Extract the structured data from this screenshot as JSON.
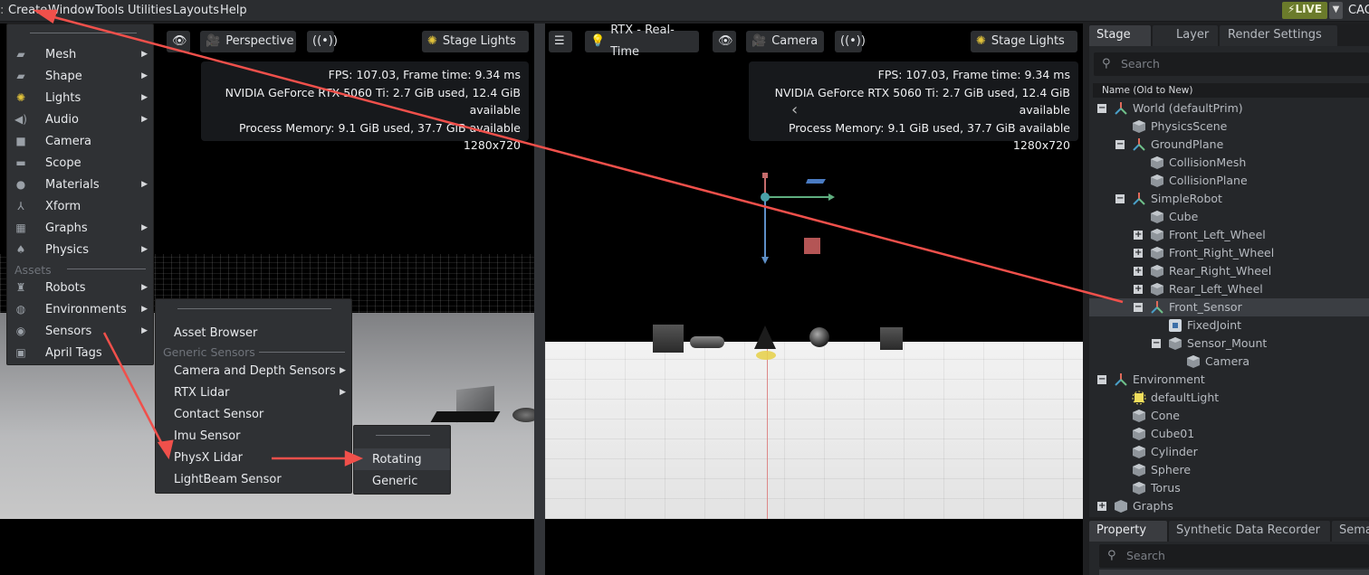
{
  "menubar": {
    "items": [
      "Create",
      "Window",
      "Tools",
      "Utilities",
      "Layouts",
      "Help"
    ],
    "live_label": "LIVE",
    "right_cut": "CAC"
  },
  "left_viewport": {
    "camera_label": "Perspective",
    "lights_label": "Stage Lights",
    "stats": [
      "FPS: 107.03, Frame time: 9.34 ms",
      "NVIDIA GeForce RTX 5060 Ti: 2.7 GiB used, 12.4 GiB available",
      "Process Memory: 9.1 GiB used, 37.7 GiB available",
      "1280x720"
    ]
  },
  "right_viewport": {
    "render_label": "RTX - Real-Time",
    "camera_label": "Camera",
    "lights_label": "Stage Lights",
    "stats": [
      "FPS: 107.03, Frame time: 9.34 ms",
      "NVIDIA GeForce RTX 5060 Ti: 2.7 GiB used, 12.4 GiB available",
      "Process Memory: 9.1 GiB used, 37.7 GiB available",
      "1280x720"
    ]
  },
  "create_menu": {
    "items": [
      {
        "label": "Mesh",
        "icon": "mesh-icon",
        "submenu": true
      },
      {
        "label": "Shape",
        "icon": "shape-icon",
        "submenu": true
      },
      {
        "label": "Lights",
        "icon": "light-icon",
        "submenu": true
      },
      {
        "label": "Audio",
        "icon": "audio-icon",
        "submenu": true
      },
      {
        "label": "Camera",
        "icon": "camera-icon",
        "submenu": false
      },
      {
        "label": "Scope",
        "icon": "folder-icon",
        "submenu": false
      },
      {
        "label": "Materials",
        "icon": "sphere-icon",
        "submenu": true
      },
      {
        "label": "Xform",
        "icon": "xform-icon",
        "submenu": false
      },
      {
        "label": "Graphs",
        "icon": "graph-icon",
        "submenu": true
      },
      {
        "label": "Physics",
        "icon": "physics-icon",
        "submenu": true
      }
    ],
    "assets_header": "Assets",
    "asset_items": [
      {
        "label": "Robots",
        "icon": "robot-icon",
        "submenu": true
      },
      {
        "label": "Environments",
        "icon": "globe-icon",
        "submenu": true
      },
      {
        "label": "Sensors",
        "icon": "sensor-icon",
        "submenu": true
      },
      {
        "label": "April Tags",
        "icon": "apriltag-icon",
        "submenu": false
      }
    ]
  },
  "sensors_menu": {
    "top_item": "Asset Browser",
    "header": "Generic Sensors",
    "items": [
      {
        "label": "Camera and Depth Sensors",
        "submenu": true
      },
      {
        "label": "RTX Lidar",
        "submenu": true
      },
      {
        "label": "Contact Sensor",
        "submenu": false
      },
      {
        "label": "Imu Sensor",
        "submenu": false
      },
      {
        "label": "PhysX Lidar",
        "submenu": false
      },
      {
        "label": "LightBeam Sensor",
        "submenu": false
      }
    ]
  },
  "physx_menu": {
    "items": [
      "Rotating",
      "Generic"
    ]
  },
  "stage": {
    "tabs": [
      "Stage",
      "Layer",
      "Render Settings"
    ],
    "search_placeholder": "Search",
    "column_header": "Name (Old to New)",
    "tree": [
      {
        "label": "World (defaultPrim)",
        "depth": 0,
        "expander": "minus",
        "icon": "xform-icon"
      },
      {
        "label": "PhysicsScene",
        "depth": 1,
        "expander": "",
        "icon": "prim-icon"
      },
      {
        "label": "GroundPlane",
        "depth": 1,
        "expander": "minus",
        "icon": "xform-icon"
      },
      {
        "label": "CollisionMesh",
        "depth": 2,
        "expander": "",
        "icon": "prim-icon"
      },
      {
        "label": "CollisionPlane",
        "depth": 2,
        "expander": "",
        "icon": "prim-icon"
      },
      {
        "label": "SimpleRobot",
        "depth": 1,
        "expander": "minus",
        "icon": "xform-icon"
      },
      {
        "label": "Cube",
        "depth": 2,
        "expander": "",
        "icon": "prim-icon"
      },
      {
        "label": "Front_Left_Wheel",
        "depth": 2,
        "expander": "plus",
        "icon": "prim-icon"
      },
      {
        "label": "Front_Right_Wheel",
        "depth": 2,
        "expander": "plus",
        "icon": "prim-icon"
      },
      {
        "label": "Rear_Right_Wheel",
        "depth": 2,
        "expander": "plus",
        "icon": "prim-icon"
      },
      {
        "label": "Rear_Left_Wheel",
        "depth": 2,
        "expander": "plus",
        "icon": "prim-icon"
      },
      {
        "label": "Front_Sensor",
        "depth": 2,
        "expander": "minus",
        "icon": "xform-icon",
        "selected": true
      },
      {
        "label": "FixedJoint",
        "depth": 3,
        "expander": "",
        "icon": "joint-icon"
      },
      {
        "label": "Sensor_Mount",
        "depth": 3,
        "expander": "minus",
        "icon": "prim-icon"
      },
      {
        "label": "Camera",
        "depth": 4,
        "expander": "",
        "icon": "camera-prim-icon"
      },
      {
        "label": "Environment",
        "depth": 0,
        "expander": "minus",
        "icon": "xform-icon"
      },
      {
        "label": "defaultLight",
        "depth": 1,
        "expander": "",
        "icon": "light-prim-icon"
      },
      {
        "label": "Cone",
        "depth": 1,
        "expander": "",
        "icon": "prim-icon"
      },
      {
        "label": "Cube01",
        "depth": 1,
        "expander": "",
        "icon": "prim-icon"
      },
      {
        "label": "Cylinder",
        "depth": 1,
        "expander": "",
        "icon": "prim-icon"
      },
      {
        "label": "Sphere",
        "depth": 1,
        "expander": "",
        "icon": "prim-icon"
      },
      {
        "label": "Torus",
        "depth": 1,
        "expander": "",
        "icon": "prim-icon"
      },
      {
        "label": "Graphs",
        "depth": 0,
        "expander": "plus",
        "icon": "graph-folder-icon"
      }
    ]
  },
  "property": {
    "tabs": [
      "Property",
      "Synthetic Data Recorder",
      "Sema"
    ],
    "search_placeholder": "Search"
  },
  "colors": {
    "annotation_red": "#f0504b",
    "live_green": "#6b7b2b",
    "selection": "#3b3e43"
  }
}
